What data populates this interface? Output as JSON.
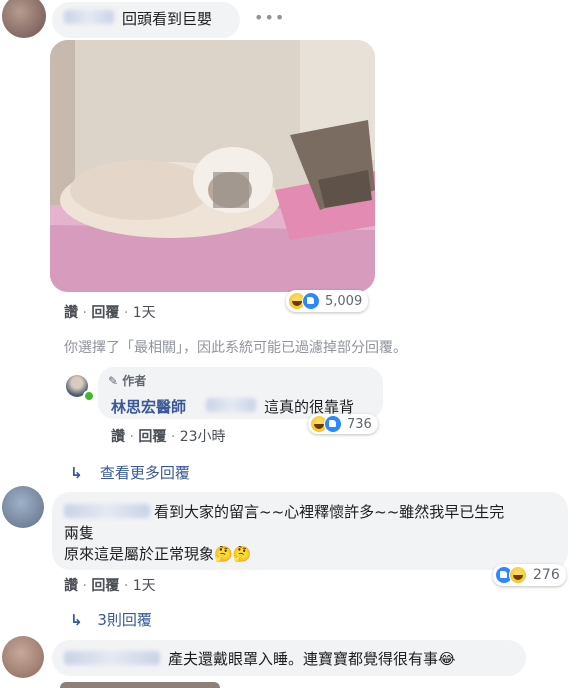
{
  "comment1": {
    "text": "回頭看到巨嬰",
    "more_icon": "more-icon",
    "like_label": "讚",
    "reply_label": "回覆",
    "time": "1天",
    "reaction_count": "5,009"
  },
  "filter_notice": "你選擇了「最相關」，因此系統可能已過濾掉部分回覆。",
  "author_reply": {
    "badge_label": "作者",
    "name": "林思宏醫師",
    "text": "這真的很靠背",
    "like_label": "讚",
    "reply_label": "回覆",
    "time": "23小時",
    "reaction_count": "736"
  },
  "view_more_replies": "查看更多回覆",
  "comment2": {
    "text_line1": "看到大家的留言~~心裡釋懷許多~~雖然我早已生完",
    "text_line2": "兩隻",
    "text_line3": "原來這是屬於正常現象",
    "like_label": "讚",
    "reply_label": "回覆",
    "time": "1天",
    "reaction_count": "276",
    "replies_link": "3則回覆"
  },
  "comment3": {
    "text": "產夫還戴眼罩入睡。連寶寶都覺得很有事"
  }
}
